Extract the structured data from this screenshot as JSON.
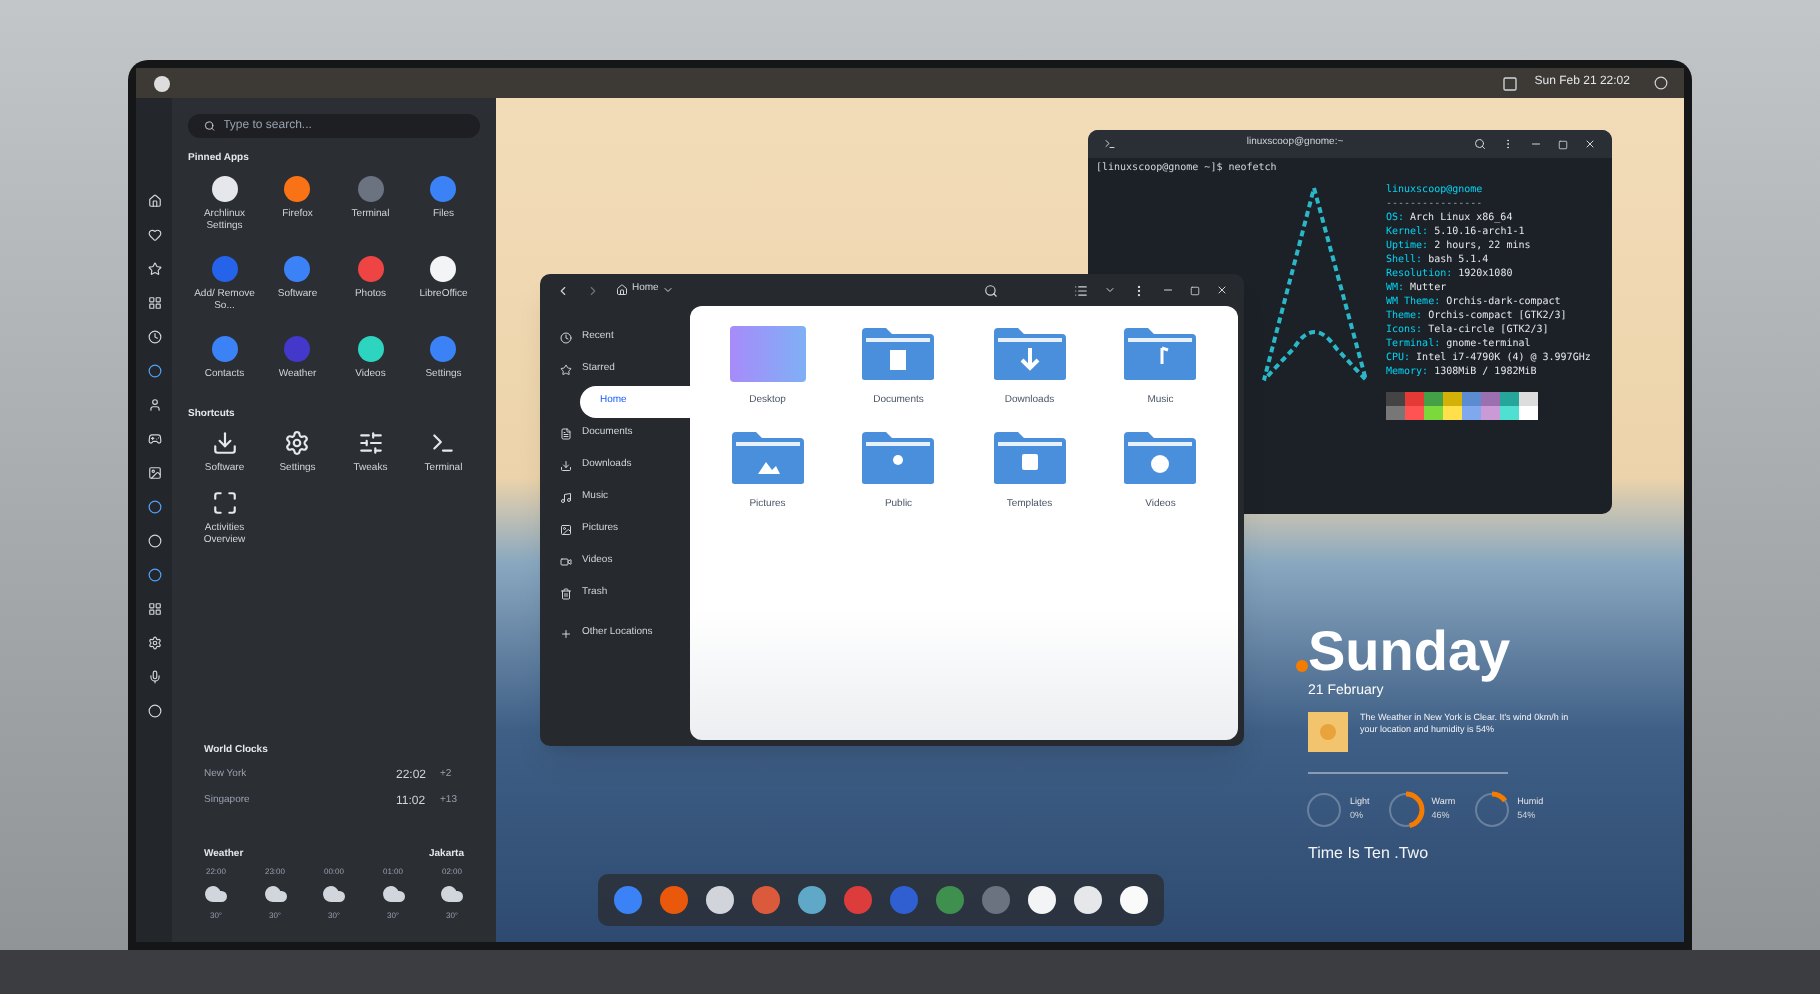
{
  "top_bar": {
    "clock": "Sun Feb 21 22:02"
  },
  "menu": {
    "search": {
      "placeholder": "Type to search..."
    },
    "pinned_title": "Pinned Apps",
    "pinned": [
      {
        "label": "Archlinux Settings",
        "color": "#e5e7eb"
      },
      {
        "label": "Firefox",
        "color": "#f97316"
      },
      {
        "label": "Terminal",
        "color": "#6b7280"
      },
      {
        "label": "Files",
        "color": "#3b82f6"
      },
      {
        "label": "Add/ Remove So...",
        "color": "#2563eb"
      },
      {
        "label": "Software",
        "color": "#3b82f6"
      },
      {
        "label": "Photos",
        "color": "#ef4444"
      },
      {
        "label": "LibreOffice",
        "color": "#f3f4f6"
      },
      {
        "label": "Contacts",
        "color": "#3b82f6"
      },
      {
        "label": "Weather",
        "color": "#4338ca"
      },
      {
        "label": "Videos",
        "color": "#2dd4bf"
      },
      {
        "label": "Settings",
        "color": "#3b82f6"
      }
    ],
    "shortcuts_title": "Shortcuts",
    "shortcuts": [
      {
        "label": "Software"
      },
      {
        "label": "Settings"
      },
      {
        "label": "Tweaks"
      },
      {
        "label": "Terminal"
      },
      {
        "label": "Activities Overview"
      }
    ],
    "world_clocks": {
      "title": "World Clocks",
      "rows": [
        {
          "city": "New York",
          "time": "22:02",
          "offset": "+2"
        },
        {
          "city": "Singapore",
          "time": "11:02",
          "offset": "+13"
        }
      ]
    },
    "weather": {
      "title": "Weather",
      "city": "Jakarta",
      "hours": [
        {
          "time": "22:00",
          "temp": "30°"
        },
        {
          "time": "23:00",
          "temp": "30°"
        },
        {
          "time": "00:00",
          "temp": "30°"
        },
        {
          "time": "01:00",
          "temp": "30°"
        },
        {
          "time": "02:00",
          "temp": "30°"
        }
      ]
    }
  },
  "terminal": {
    "title": "linuxscoop@gnome:~",
    "prompt": "[linuxscoop@gnome ~]$ neofetch",
    "header": "linuxscoop@gnome",
    "rule": "----------------",
    "info": [
      {
        "key": "OS:",
        "value": "Arch Linux x86_64"
      },
      {
        "key": "Kernel:",
        "value": "5.10.16-arch1-1"
      },
      {
        "key": "Uptime:",
        "value": "2 hours, 22 mins"
      },
      {
        "key": "Shell:",
        "value": "bash 5.1.4"
      },
      {
        "key": "Resolution:",
        "value": "1920x1080"
      },
      {
        "key": "WM:",
        "value": "Mutter"
      },
      {
        "key": "WM Theme:",
        "value": "Orchis-dark-compact"
      },
      {
        "key": "Theme:",
        "value": "Orchis-compact [GTK2/3]"
      },
      {
        "key": "Icons:",
        "value": "Tela-circle [GTK2/3]"
      },
      {
        "key": "Terminal:",
        "value": "gnome-terminal"
      },
      {
        "key": "CPU:",
        "value": "Intel i7-4790K (4) @ 3.997GHz"
      },
      {
        "key": "Memory:",
        "value": "1308MiB / 1982MiB"
      }
    ]
  },
  "files": {
    "location": "Home",
    "sidebar": [
      {
        "label": "Recent",
        "selected": false
      },
      {
        "label": "Starred",
        "selected": false
      },
      {
        "label": "Home",
        "selected": true
      },
      {
        "label": "Documents",
        "selected": false
      },
      {
        "label": "Downloads",
        "selected": false
      },
      {
        "label": "Music",
        "selected": false
      },
      {
        "label": "Pictures",
        "selected": false
      },
      {
        "label": "Videos",
        "selected": false
      },
      {
        "label": "Trash",
        "selected": false
      },
      {
        "label": "Other Locations",
        "selected": false
      }
    ],
    "items": [
      {
        "label": "Desktop",
        "kind": "desktop"
      },
      {
        "label": "Documents",
        "kind": "folder"
      },
      {
        "label": "Downloads",
        "kind": "folder"
      },
      {
        "label": "Music",
        "kind": "folder"
      },
      {
        "label": "Pictures",
        "kind": "folder"
      },
      {
        "label": "Public",
        "kind": "folder"
      },
      {
        "label": "Templates",
        "kind": "folder"
      },
      {
        "label": "Videos",
        "kind": "folder"
      }
    ]
  },
  "widget": {
    "day": "Sunday",
    "date": "21 February",
    "summary": "The Weather in New York is Clear. It's wind 0km/h in your location and humidity is 54%",
    "rings": [
      {
        "label": "Light",
        "value": "0%",
        "level": 0
      },
      {
        "label": "Warm",
        "value": "46%",
        "level": 0.46
      },
      {
        "label": "Humid",
        "value": "54%",
        "level": 0.15
      }
    ],
    "time": "Time Is Ten .Two"
  },
  "dock": [
    {
      "color": "#3b82f6"
    },
    {
      "color": "#ea580c"
    },
    {
      "color": "#d1d5db"
    },
    {
      "color": "#dc5a3c"
    },
    {
      "color": "#5fa8c8"
    },
    {
      "color": "#dc3c3c"
    },
    {
      "color": "#2f5fd0"
    },
    {
      "color": "#3f8f4f"
    },
    {
      "color": "#6b7280"
    },
    {
      "color": "#f3f4f6"
    },
    {
      "color": "#e5e7eb"
    },
    {
      "color": "#fafafa"
    }
  ]
}
